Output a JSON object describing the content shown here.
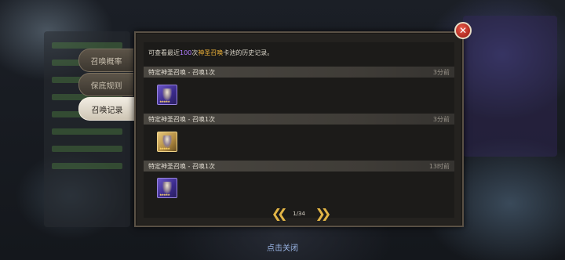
{
  "dialog": {
    "info_prefix": "可查看最近",
    "info_count": "100",
    "info_unit": "次",
    "info_highlight": "神圣召唤",
    "info_suffix": "卡池的历史记录。"
  },
  "tabs": [
    {
      "label": "召唤概率",
      "active": false
    },
    {
      "label": "保底规则",
      "active": false
    },
    {
      "label": "召唤记录",
      "active": true
    }
  ],
  "records": [
    {
      "title": "特定神圣召唤 - 召唤1次",
      "time": "3分前",
      "hero_style": "purple",
      "stars": "★★★★★"
    },
    {
      "title": "特定神圣召唤 - 召唤1次",
      "time": "3分前",
      "hero_style": "gold",
      "stars": "★★★★★"
    },
    {
      "title": "特定神圣召唤 - 召唤1次",
      "time": "13时前",
      "hero_style": "purple",
      "stars": "★★★★★"
    }
  ],
  "pager": {
    "prev_icon": "double-chevron-left-icon",
    "next_icon": "double-chevron-right-icon",
    "page": "1/34"
  },
  "close_label": "点击关闭",
  "colors": {
    "highlight": "#f0b43a",
    "count": "#b07cff",
    "arrow": "#e2b546"
  }
}
